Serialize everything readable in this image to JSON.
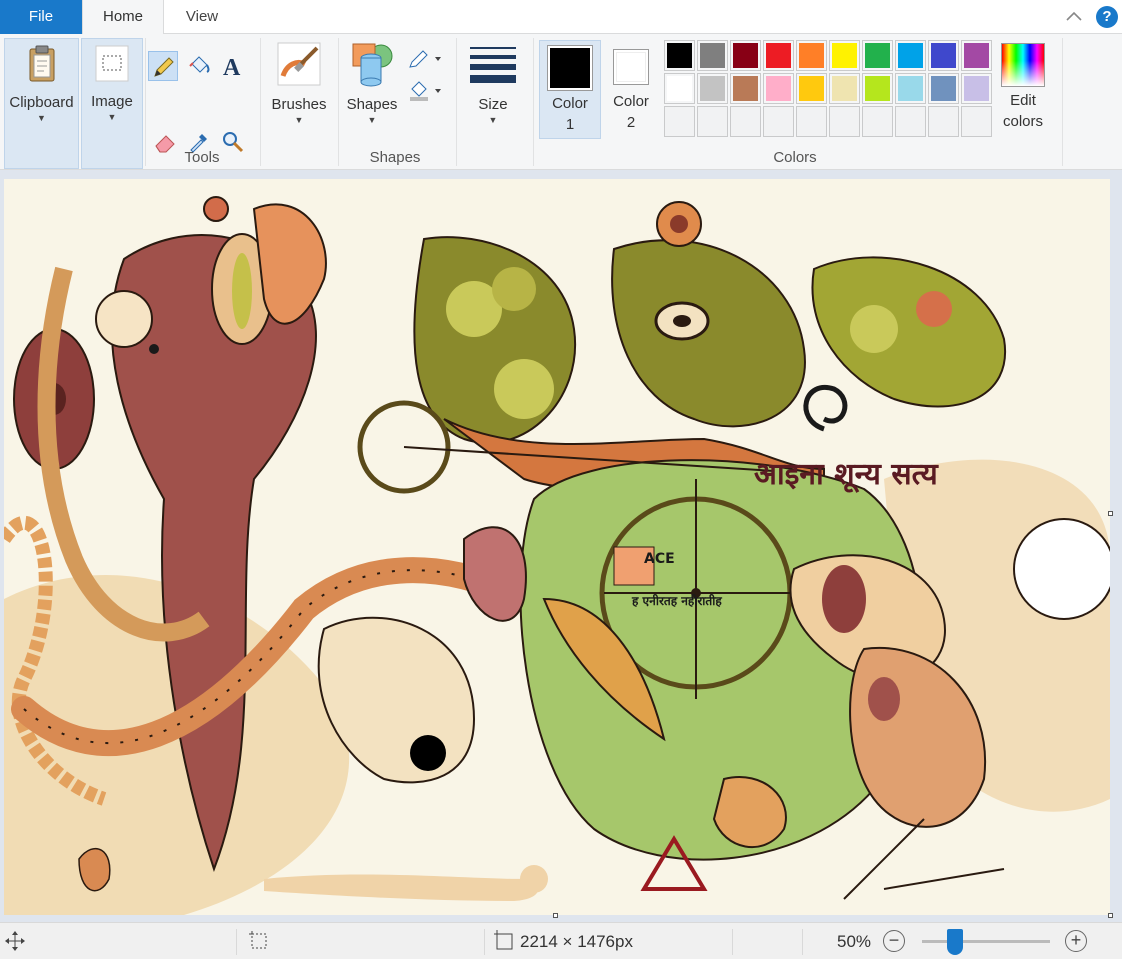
{
  "tabs": {
    "file": "File",
    "home": "Home",
    "view": "View",
    "help": "?"
  },
  "ribbon": {
    "clipboard": "Clipboard",
    "image": "Image",
    "tools_group": "Tools",
    "brushes": "Brushes",
    "shapes": "Shapes",
    "shapes_group": "Shapes",
    "size": "Size",
    "color1": "Color",
    "color1_num": "1",
    "color2": "Color",
    "color2_num": "2",
    "colors_group": "Colors",
    "edit_colors_1": "Edit",
    "edit_colors_2": "colors",
    "active_color": "#000000",
    "secondary_color": "#ffffff",
    "palette_row1": [
      "#000000",
      "#7f7f7f",
      "#880015",
      "#ed1c24",
      "#ff7f27",
      "#fff200",
      "#22b14c",
      "#00a2e8",
      "#3f48cc",
      "#a349a4"
    ],
    "palette_row2": [
      "#ffffff",
      "#c3c3c3",
      "#b97a57",
      "#ffaec9",
      "#ffc90e",
      "#efe4b0",
      "#b5e61d",
      "#99d9ea",
      "#7092be",
      "#c8bfe7"
    ]
  },
  "canvas": {
    "title_text": "आइना शून्य  सत्य",
    "label_ace": "ACE",
    "label_sub": "ह एनीरतह नहीरातीह"
  },
  "status": {
    "dimensions": "2214 × 1476px",
    "zoom": "50%",
    "zoom_out": "−",
    "zoom_in": "+",
    "zoom_level": 0.22
  }
}
